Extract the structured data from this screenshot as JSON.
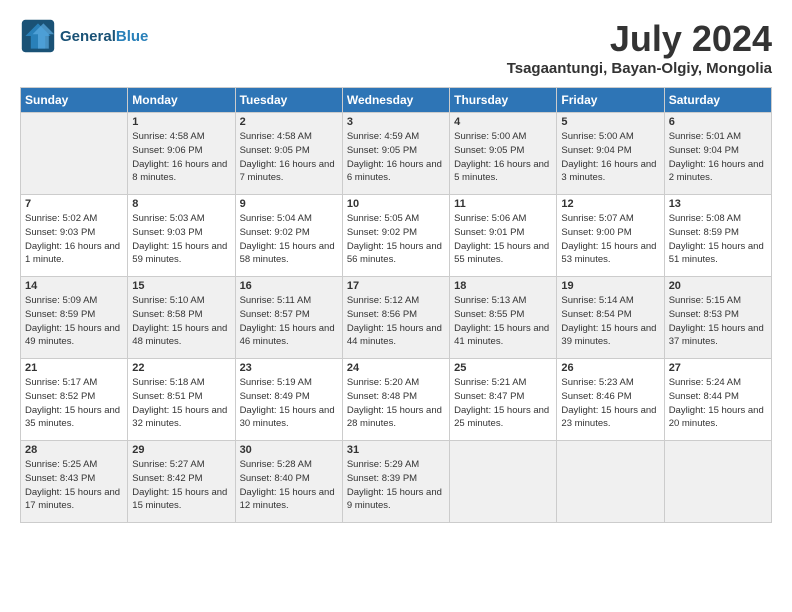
{
  "header": {
    "logo_line1": "General",
    "logo_line2": "Blue",
    "month_title": "July 2024",
    "subtitle": "Tsagaantungi, Bayan-Olgiy, Mongolia"
  },
  "days_of_week": [
    "Sunday",
    "Monday",
    "Tuesday",
    "Wednesday",
    "Thursday",
    "Friday",
    "Saturday"
  ],
  "weeks": [
    [
      {
        "day": "",
        "sunrise": "",
        "sunset": "",
        "daylight": ""
      },
      {
        "day": "1",
        "sunrise": "Sunrise: 4:58 AM",
        "sunset": "Sunset: 9:06 PM",
        "daylight": "Daylight: 16 hours and 8 minutes."
      },
      {
        "day": "2",
        "sunrise": "Sunrise: 4:58 AM",
        "sunset": "Sunset: 9:05 PM",
        "daylight": "Daylight: 16 hours and 7 minutes."
      },
      {
        "day": "3",
        "sunrise": "Sunrise: 4:59 AM",
        "sunset": "Sunset: 9:05 PM",
        "daylight": "Daylight: 16 hours and 6 minutes."
      },
      {
        "day": "4",
        "sunrise": "Sunrise: 5:00 AM",
        "sunset": "Sunset: 9:05 PM",
        "daylight": "Daylight: 16 hours and 5 minutes."
      },
      {
        "day": "5",
        "sunrise": "Sunrise: 5:00 AM",
        "sunset": "Sunset: 9:04 PM",
        "daylight": "Daylight: 16 hours and 3 minutes."
      },
      {
        "day": "6",
        "sunrise": "Sunrise: 5:01 AM",
        "sunset": "Sunset: 9:04 PM",
        "daylight": "Daylight: 16 hours and 2 minutes."
      }
    ],
    [
      {
        "day": "7",
        "sunrise": "Sunrise: 5:02 AM",
        "sunset": "Sunset: 9:03 PM",
        "daylight": "Daylight: 16 hours and 1 minute."
      },
      {
        "day": "8",
        "sunrise": "Sunrise: 5:03 AM",
        "sunset": "Sunset: 9:03 PM",
        "daylight": "Daylight: 15 hours and 59 minutes."
      },
      {
        "day": "9",
        "sunrise": "Sunrise: 5:04 AM",
        "sunset": "Sunset: 9:02 PM",
        "daylight": "Daylight: 15 hours and 58 minutes."
      },
      {
        "day": "10",
        "sunrise": "Sunrise: 5:05 AM",
        "sunset": "Sunset: 9:02 PM",
        "daylight": "Daylight: 15 hours and 56 minutes."
      },
      {
        "day": "11",
        "sunrise": "Sunrise: 5:06 AM",
        "sunset": "Sunset: 9:01 PM",
        "daylight": "Daylight: 15 hours and 55 minutes."
      },
      {
        "day": "12",
        "sunrise": "Sunrise: 5:07 AM",
        "sunset": "Sunset: 9:00 PM",
        "daylight": "Daylight: 15 hours and 53 minutes."
      },
      {
        "day": "13",
        "sunrise": "Sunrise: 5:08 AM",
        "sunset": "Sunset: 8:59 PM",
        "daylight": "Daylight: 15 hours and 51 minutes."
      }
    ],
    [
      {
        "day": "14",
        "sunrise": "Sunrise: 5:09 AM",
        "sunset": "Sunset: 8:59 PM",
        "daylight": "Daylight: 15 hours and 49 minutes."
      },
      {
        "day": "15",
        "sunrise": "Sunrise: 5:10 AM",
        "sunset": "Sunset: 8:58 PM",
        "daylight": "Daylight: 15 hours and 48 minutes."
      },
      {
        "day": "16",
        "sunrise": "Sunrise: 5:11 AM",
        "sunset": "Sunset: 8:57 PM",
        "daylight": "Daylight: 15 hours and 46 minutes."
      },
      {
        "day": "17",
        "sunrise": "Sunrise: 5:12 AM",
        "sunset": "Sunset: 8:56 PM",
        "daylight": "Daylight: 15 hours and 44 minutes."
      },
      {
        "day": "18",
        "sunrise": "Sunrise: 5:13 AM",
        "sunset": "Sunset: 8:55 PM",
        "daylight": "Daylight: 15 hours and 41 minutes."
      },
      {
        "day": "19",
        "sunrise": "Sunrise: 5:14 AM",
        "sunset": "Sunset: 8:54 PM",
        "daylight": "Daylight: 15 hours and 39 minutes."
      },
      {
        "day": "20",
        "sunrise": "Sunrise: 5:15 AM",
        "sunset": "Sunset: 8:53 PM",
        "daylight": "Daylight: 15 hours and 37 minutes."
      }
    ],
    [
      {
        "day": "21",
        "sunrise": "Sunrise: 5:17 AM",
        "sunset": "Sunset: 8:52 PM",
        "daylight": "Daylight: 15 hours and 35 minutes."
      },
      {
        "day": "22",
        "sunrise": "Sunrise: 5:18 AM",
        "sunset": "Sunset: 8:51 PM",
        "daylight": "Daylight: 15 hours and 32 minutes."
      },
      {
        "day": "23",
        "sunrise": "Sunrise: 5:19 AM",
        "sunset": "Sunset: 8:49 PM",
        "daylight": "Daylight: 15 hours and 30 minutes."
      },
      {
        "day": "24",
        "sunrise": "Sunrise: 5:20 AM",
        "sunset": "Sunset: 8:48 PM",
        "daylight": "Daylight: 15 hours and 28 minutes."
      },
      {
        "day": "25",
        "sunrise": "Sunrise: 5:21 AM",
        "sunset": "Sunset: 8:47 PM",
        "daylight": "Daylight: 15 hours and 25 minutes."
      },
      {
        "day": "26",
        "sunrise": "Sunrise: 5:23 AM",
        "sunset": "Sunset: 8:46 PM",
        "daylight": "Daylight: 15 hours and 23 minutes."
      },
      {
        "day": "27",
        "sunrise": "Sunrise: 5:24 AM",
        "sunset": "Sunset: 8:44 PM",
        "daylight": "Daylight: 15 hours and 20 minutes."
      }
    ],
    [
      {
        "day": "28",
        "sunrise": "Sunrise: 5:25 AM",
        "sunset": "Sunset: 8:43 PM",
        "daylight": "Daylight: 15 hours and 17 minutes."
      },
      {
        "day": "29",
        "sunrise": "Sunrise: 5:27 AM",
        "sunset": "Sunset: 8:42 PM",
        "daylight": "Daylight: 15 hours and 15 minutes."
      },
      {
        "day": "30",
        "sunrise": "Sunrise: 5:28 AM",
        "sunset": "Sunset: 8:40 PM",
        "daylight": "Daylight: 15 hours and 12 minutes."
      },
      {
        "day": "31",
        "sunrise": "Sunrise: 5:29 AM",
        "sunset": "Sunset: 8:39 PM",
        "daylight": "Daylight: 15 hours and 9 minutes."
      },
      {
        "day": "",
        "sunrise": "",
        "sunset": "",
        "daylight": ""
      },
      {
        "day": "",
        "sunrise": "",
        "sunset": "",
        "daylight": ""
      },
      {
        "day": "",
        "sunrise": "",
        "sunset": "",
        "daylight": ""
      }
    ]
  ]
}
